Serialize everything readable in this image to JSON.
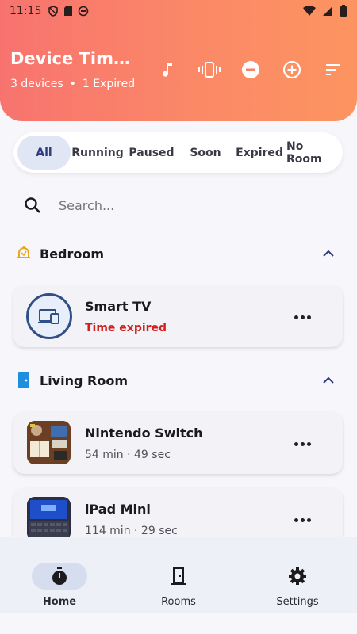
{
  "status_bar": {
    "time": "11:15"
  },
  "header": {
    "title": "Device Time…",
    "device_count": "3 devices",
    "separator": "•",
    "expired_count": "1 Expired"
  },
  "filters": {
    "tabs": [
      {
        "label": "All",
        "active": true
      },
      {
        "label": "Running"
      },
      {
        "label": "Paused"
      },
      {
        "label": "Soon"
      },
      {
        "label": "Expired"
      },
      {
        "label": "No Room"
      }
    ]
  },
  "search": {
    "placeholder": "Search..."
  },
  "sections": [
    {
      "label": "Bedroom",
      "devices": [
        {
          "name": "Smart TV",
          "status": "Time expired"
        }
      ]
    },
    {
      "label": "Living Room",
      "devices": [
        {
          "name": "Nintendo Switch",
          "status": "54 min · 49 sec"
        },
        {
          "name": "iPad Mini",
          "status": "114 min · 29 sec"
        }
      ]
    }
  ],
  "bottom_nav": [
    {
      "label": "Home",
      "active": true
    },
    {
      "label": "Rooms"
    },
    {
      "label": "Settings"
    }
  ],
  "colors": {
    "accent": "#2f3d80",
    "header_start": "#f8736f",
    "header_end": "#fd9460",
    "expired": "#d21f1f"
  }
}
